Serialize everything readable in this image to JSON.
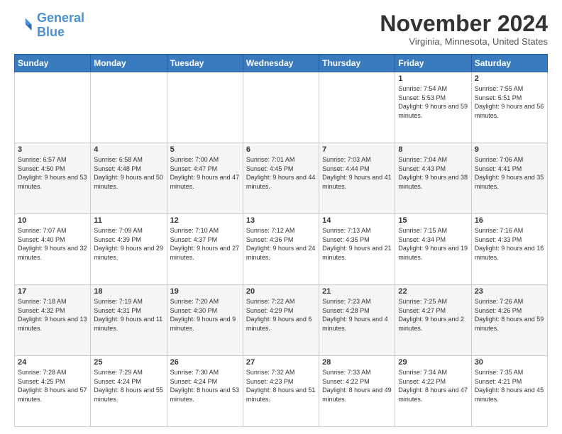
{
  "header": {
    "logo_line1": "General",
    "logo_line2": "Blue",
    "month": "November 2024",
    "location": "Virginia, Minnesota, United States"
  },
  "days_of_week": [
    "Sunday",
    "Monday",
    "Tuesday",
    "Wednesday",
    "Thursday",
    "Friday",
    "Saturday"
  ],
  "weeks": [
    [
      {
        "day": "",
        "info": ""
      },
      {
        "day": "",
        "info": ""
      },
      {
        "day": "",
        "info": ""
      },
      {
        "day": "",
        "info": ""
      },
      {
        "day": "",
        "info": ""
      },
      {
        "day": "1",
        "info": "Sunrise: 7:54 AM\nSunset: 5:53 PM\nDaylight: 9 hours and 59 minutes."
      },
      {
        "day": "2",
        "info": "Sunrise: 7:55 AM\nSunset: 5:51 PM\nDaylight: 9 hours and 56 minutes."
      }
    ],
    [
      {
        "day": "3",
        "info": "Sunrise: 6:57 AM\nSunset: 4:50 PM\nDaylight: 9 hours and 53 minutes."
      },
      {
        "day": "4",
        "info": "Sunrise: 6:58 AM\nSunset: 4:48 PM\nDaylight: 9 hours and 50 minutes."
      },
      {
        "day": "5",
        "info": "Sunrise: 7:00 AM\nSunset: 4:47 PM\nDaylight: 9 hours and 47 minutes."
      },
      {
        "day": "6",
        "info": "Sunrise: 7:01 AM\nSunset: 4:45 PM\nDaylight: 9 hours and 44 minutes."
      },
      {
        "day": "7",
        "info": "Sunrise: 7:03 AM\nSunset: 4:44 PM\nDaylight: 9 hours and 41 minutes."
      },
      {
        "day": "8",
        "info": "Sunrise: 7:04 AM\nSunset: 4:43 PM\nDaylight: 9 hours and 38 minutes."
      },
      {
        "day": "9",
        "info": "Sunrise: 7:06 AM\nSunset: 4:41 PM\nDaylight: 9 hours and 35 minutes."
      }
    ],
    [
      {
        "day": "10",
        "info": "Sunrise: 7:07 AM\nSunset: 4:40 PM\nDaylight: 9 hours and 32 minutes."
      },
      {
        "day": "11",
        "info": "Sunrise: 7:09 AM\nSunset: 4:39 PM\nDaylight: 9 hours and 29 minutes."
      },
      {
        "day": "12",
        "info": "Sunrise: 7:10 AM\nSunset: 4:37 PM\nDaylight: 9 hours and 27 minutes."
      },
      {
        "day": "13",
        "info": "Sunrise: 7:12 AM\nSunset: 4:36 PM\nDaylight: 9 hours and 24 minutes."
      },
      {
        "day": "14",
        "info": "Sunrise: 7:13 AM\nSunset: 4:35 PM\nDaylight: 9 hours and 21 minutes."
      },
      {
        "day": "15",
        "info": "Sunrise: 7:15 AM\nSunset: 4:34 PM\nDaylight: 9 hours and 19 minutes."
      },
      {
        "day": "16",
        "info": "Sunrise: 7:16 AM\nSunset: 4:33 PM\nDaylight: 9 hours and 16 minutes."
      }
    ],
    [
      {
        "day": "17",
        "info": "Sunrise: 7:18 AM\nSunset: 4:32 PM\nDaylight: 9 hours and 13 minutes."
      },
      {
        "day": "18",
        "info": "Sunrise: 7:19 AM\nSunset: 4:31 PM\nDaylight: 9 hours and 11 minutes."
      },
      {
        "day": "19",
        "info": "Sunrise: 7:20 AM\nSunset: 4:30 PM\nDaylight: 9 hours and 9 minutes."
      },
      {
        "day": "20",
        "info": "Sunrise: 7:22 AM\nSunset: 4:29 PM\nDaylight: 9 hours and 6 minutes."
      },
      {
        "day": "21",
        "info": "Sunrise: 7:23 AM\nSunset: 4:28 PM\nDaylight: 9 hours and 4 minutes."
      },
      {
        "day": "22",
        "info": "Sunrise: 7:25 AM\nSunset: 4:27 PM\nDaylight: 9 hours and 2 minutes."
      },
      {
        "day": "23",
        "info": "Sunrise: 7:26 AM\nSunset: 4:26 PM\nDaylight: 8 hours and 59 minutes."
      }
    ],
    [
      {
        "day": "24",
        "info": "Sunrise: 7:28 AM\nSunset: 4:25 PM\nDaylight: 8 hours and 57 minutes."
      },
      {
        "day": "25",
        "info": "Sunrise: 7:29 AM\nSunset: 4:24 PM\nDaylight: 8 hours and 55 minutes."
      },
      {
        "day": "26",
        "info": "Sunrise: 7:30 AM\nSunset: 4:24 PM\nDaylight: 8 hours and 53 minutes."
      },
      {
        "day": "27",
        "info": "Sunrise: 7:32 AM\nSunset: 4:23 PM\nDaylight: 8 hours and 51 minutes."
      },
      {
        "day": "28",
        "info": "Sunrise: 7:33 AM\nSunset: 4:22 PM\nDaylight: 8 hours and 49 minutes."
      },
      {
        "day": "29",
        "info": "Sunrise: 7:34 AM\nSunset: 4:22 PM\nDaylight: 8 hours and 47 minutes."
      },
      {
        "day": "30",
        "info": "Sunrise: 7:35 AM\nSunset: 4:21 PM\nDaylight: 8 hours and 45 minutes."
      }
    ]
  ]
}
